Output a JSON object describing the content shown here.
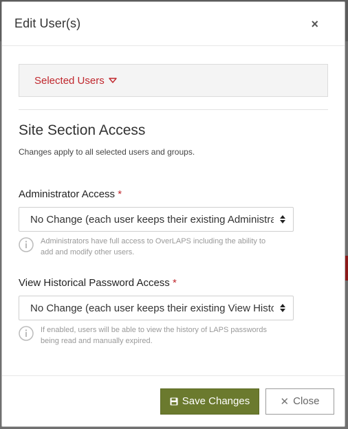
{
  "modal": {
    "title": "Edit User(s)",
    "close_glyph": "×"
  },
  "selected_users": {
    "label": "Selected Users",
    "icon": "caret-down-icon",
    "color": "#c0272d"
  },
  "section": {
    "title": "Site Section Access",
    "description": "Changes apply to all selected users and groups."
  },
  "fields": [
    {
      "label": "Administrator Access",
      "required_mark": "*",
      "selected_value": "No Change (each user keeps their existing Administrator Access setting)",
      "help": "Administrators have full access to OverLAPS including the ability to add and modify other users."
    },
    {
      "label": "View Historical Password Access",
      "required_mark": "*",
      "selected_value": "No Change (each user keeps their existing View Historical Password Access setting)",
      "help": "If enabled, users will be able to view the history of LAPS passwords being read and manually expired."
    }
  ],
  "footer": {
    "save_label": "Save Changes",
    "close_label": "Close"
  },
  "colors": {
    "accent_red": "#c0272d",
    "save_button": "#6b7a2e"
  }
}
